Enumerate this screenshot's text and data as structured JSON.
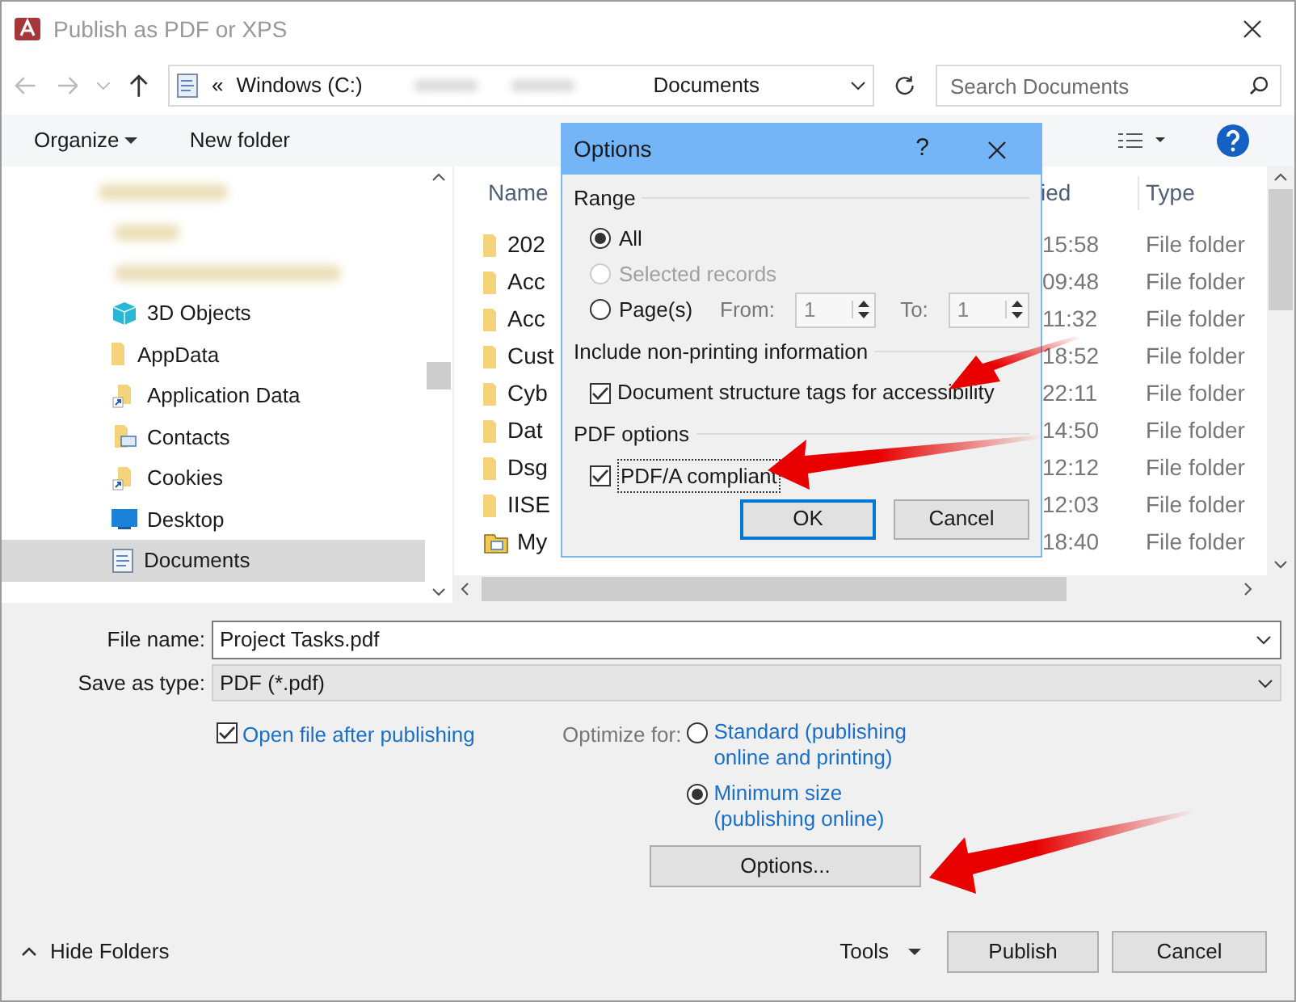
{
  "window": {
    "title": "Publish as PDF or XPS"
  },
  "address_bar": {
    "chevron": "«",
    "segments": [
      "Windows (C:)",
      "Documents"
    ],
    "search_placeholder": "Search Documents"
  },
  "toolbar": {
    "organize": "Organize",
    "new_folder": "New folder"
  },
  "sidebar": {
    "items": [
      {
        "label": "3D Objects",
        "kind": "objects",
        "selected": false
      },
      {
        "label": "AppData",
        "kind": "folder",
        "selected": false
      },
      {
        "label": "Application Data",
        "kind": "shortcut",
        "selected": false
      },
      {
        "label": "Contacts",
        "kind": "contacts",
        "selected": false
      },
      {
        "label": "Cookies",
        "kind": "shortcut",
        "selected": false
      },
      {
        "label": "Desktop",
        "kind": "desktop",
        "selected": false
      },
      {
        "label": "Documents",
        "kind": "documents",
        "selected": true
      }
    ]
  },
  "file_list": {
    "columns": [
      "Name",
      "ied",
      "Type"
    ],
    "rows": [
      {
        "name": "202",
        "modified": "15:58",
        "type": "File folder",
        "kind": "folder"
      },
      {
        "name": "Acc",
        "modified": "09:48",
        "type": "File folder",
        "kind": "folder"
      },
      {
        "name": "Acc",
        "modified": "11:32",
        "type": "File folder",
        "kind": "folder"
      },
      {
        "name": "Cust",
        "modified": "18:52",
        "type": "File folder",
        "kind": "folder"
      },
      {
        "name": "Cyb",
        "modified": "22:11",
        "type": "File folder",
        "kind": "folder"
      },
      {
        "name": "Dat",
        "modified": "14:50",
        "type": "File folder",
        "kind": "folder"
      },
      {
        "name": "Dsg",
        "modified": "12:12",
        "type": "File folder",
        "kind": "folder"
      },
      {
        "name": "IISE",
        "modified": "12:03",
        "type": "File folder",
        "kind": "folder"
      },
      {
        "name": "My",
        "modified": "18:40",
        "type": "File folder",
        "kind": "special"
      }
    ]
  },
  "options_dialog": {
    "title": "Options",
    "help": "?",
    "range_heading": "Range",
    "range_options": [
      {
        "label": "All",
        "selected": true,
        "disabled": false
      },
      {
        "label": "Selected records",
        "selected": false,
        "disabled": true
      },
      {
        "label": "Page(s)",
        "selected": false,
        "disabled": false
      }
    ],
    "from_label": "From:",
    "from_value": "1",
    "to_label": "To:",
    "to_value": "1",
    "nonprinting_heading": "Include non-printing information",
    "nonprinting_options": [
      {
        "label": "Document structure tags for accessibility",
        "checked": true
      }
    ],
    "pdf_heading": "PDF options",
    "pdf_options": [
      {
        "label": "PDF/A compliant",
        "checked": true
      }
    ],
    "ok": "OK",
    "cancel": "Cancel"
  },
  "form": {
    "file_name_label": "File name:",
    "file_name": "Project Tasks.pdf",
    "save_type_label": "Save as type:",
    "save_type": "PDF (*.pdf)",
    "open_after": {
      "label": "Open file after publishing",
      "checked": true
    },
    "optimize_label": "Optimize for:",
    "optimize_options": [
      {
        "label": "Standard (publishing online and printing)",
        "selected": false
      },
      {
        "label": "Minimum size (publishing online)",
        "selected": true
      }
    ],
    "options_button": "Options..."
  },
  "footer": {
    "hide_folders": "Hide Folders",
    "tools": "Tools",
    "publish": "Publish",
    "cancel": "Cancel"
  }
}
